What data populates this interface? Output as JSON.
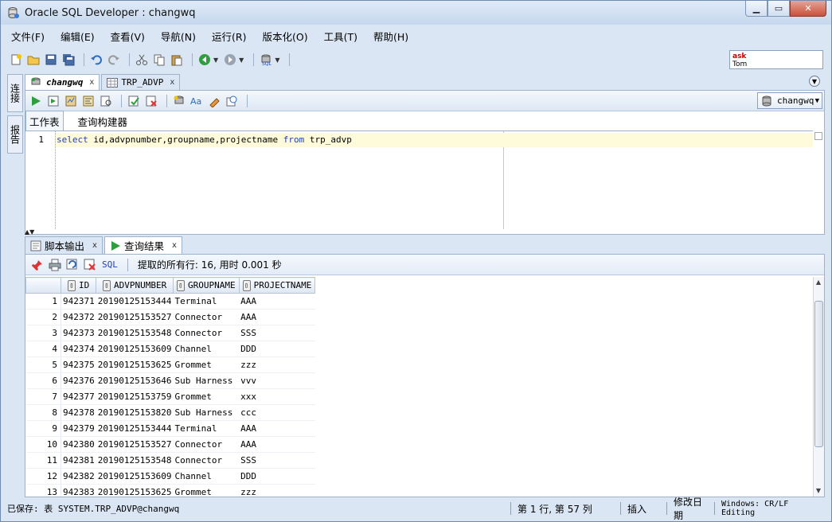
{
  "window": {
    "title": "Oracle SQL Developer : changwq"
  },
  "menu": [
    "文件(F)",
    "编辑(E)",
    "查看(V)",
    "导航(N)",
    "运行(R)",
    "版本化(O)",
    "工具(T)",
    "帮助(H)"
  ],
  "ask_box": {
    "line1": "ask",
    "line2": "Tom"
  },
  "left_strip": {
    "connections": "连接",
    "reports": "报告"
  },
  "editor_tabs": [
    {
      "label": "changwq",
      "close": "x"
    },
    {
      "label": "TRP_ADVP",
      "close": "x"
    }
  ],
  "connection_selector": {
    "value": "changwq"
  },
  "sub_tabs": {
    "worksheet": "工作表",
    "query_builder": "查询构建器"
  },
  "editor": {
    "line_number": "1",
    "kw_select": "select",
    "cols": " id,advpnumber,groupname,projectname ",
    "kw_from": "from",
    "table": " trp_advp"
  },
  "result_tabs": [
    {
      "label": "脚本输出",
      "close": "x"
    },
    {
      "label": "查询结果",
      "close": "x"
    }
  ],
  "result_toolbar": {
    "sql_label": "SQL",
    "status": "提取的所有行: 16, 用时 0.001 秒"
  },
  "grid": {
    "columns": [
      "ID",
      "ADVPNUMBER",
      "GROUPNAME",
      "PROJECTNAME"
    ],
    "rows": [
      [
        "1",
        "942371",
        "20190125153444",
        "Terminal",
        "AAA"
      ],
      [
        "2",
        "942372",
        "20190125153527",
        "Connector",
        "AAA"
      ],
      [
        "3",
        "942373",
        "20190125153548",
        "Connector",
        "SSS"
      ],
      [
        "4",
        "942374",
        "20190125153609",
        "Channel",
        "DDD"
      ],
      [
        "5",
        "942375",
        "20190125153625",
        "Grommet",
        "zzz"
      ],
      [
        "6",
        "942376",
        "20190125153646",
        "Sub Harness",
        "vvv"
      ],
      [
        "7",
        "942377",
        "20190125153759",
        "Grommet",
        "xxx"
      ],
      [
        "8",
        "942378",
        "20190125153820",
        "Sub Harness",
        "ccc"
      ],
      [
        "9",
        "942379",
        "20190125153444",
        "Terminal",
        "AAA"
      ],
      [
        "10",
        "942380",
        "20190125153527",
        "Connector",
        "AAA"
      ],
      [
        "11",
        "942381",
        "20190125153548",
        "Connector",
        "SSS"
      ],
      [
        "12",
        "942382",
        "20190125153609",
        "Channel",
        "DDD"
      ],
      [
        "13",
        "942383",
        "20190125153625",
        "Grommet",
        "zzz"
      ]
    ]
  },
  "statusbar": {
    "saved": "已保存: 表 SYSTEM.TRP_ADVP@changwq",
    "position": "第 1 行, 第 57 列",
    "mode": "插入",
    "modified": "修改日期",
    "line_endings": "Windows: CR/LF Editing"
  },
  "colors": {
    "keyword": "#1f3fb6",
    "current_line": "#fdfbd9",
    "window_bg": "#dbe6f4"
  }
}
